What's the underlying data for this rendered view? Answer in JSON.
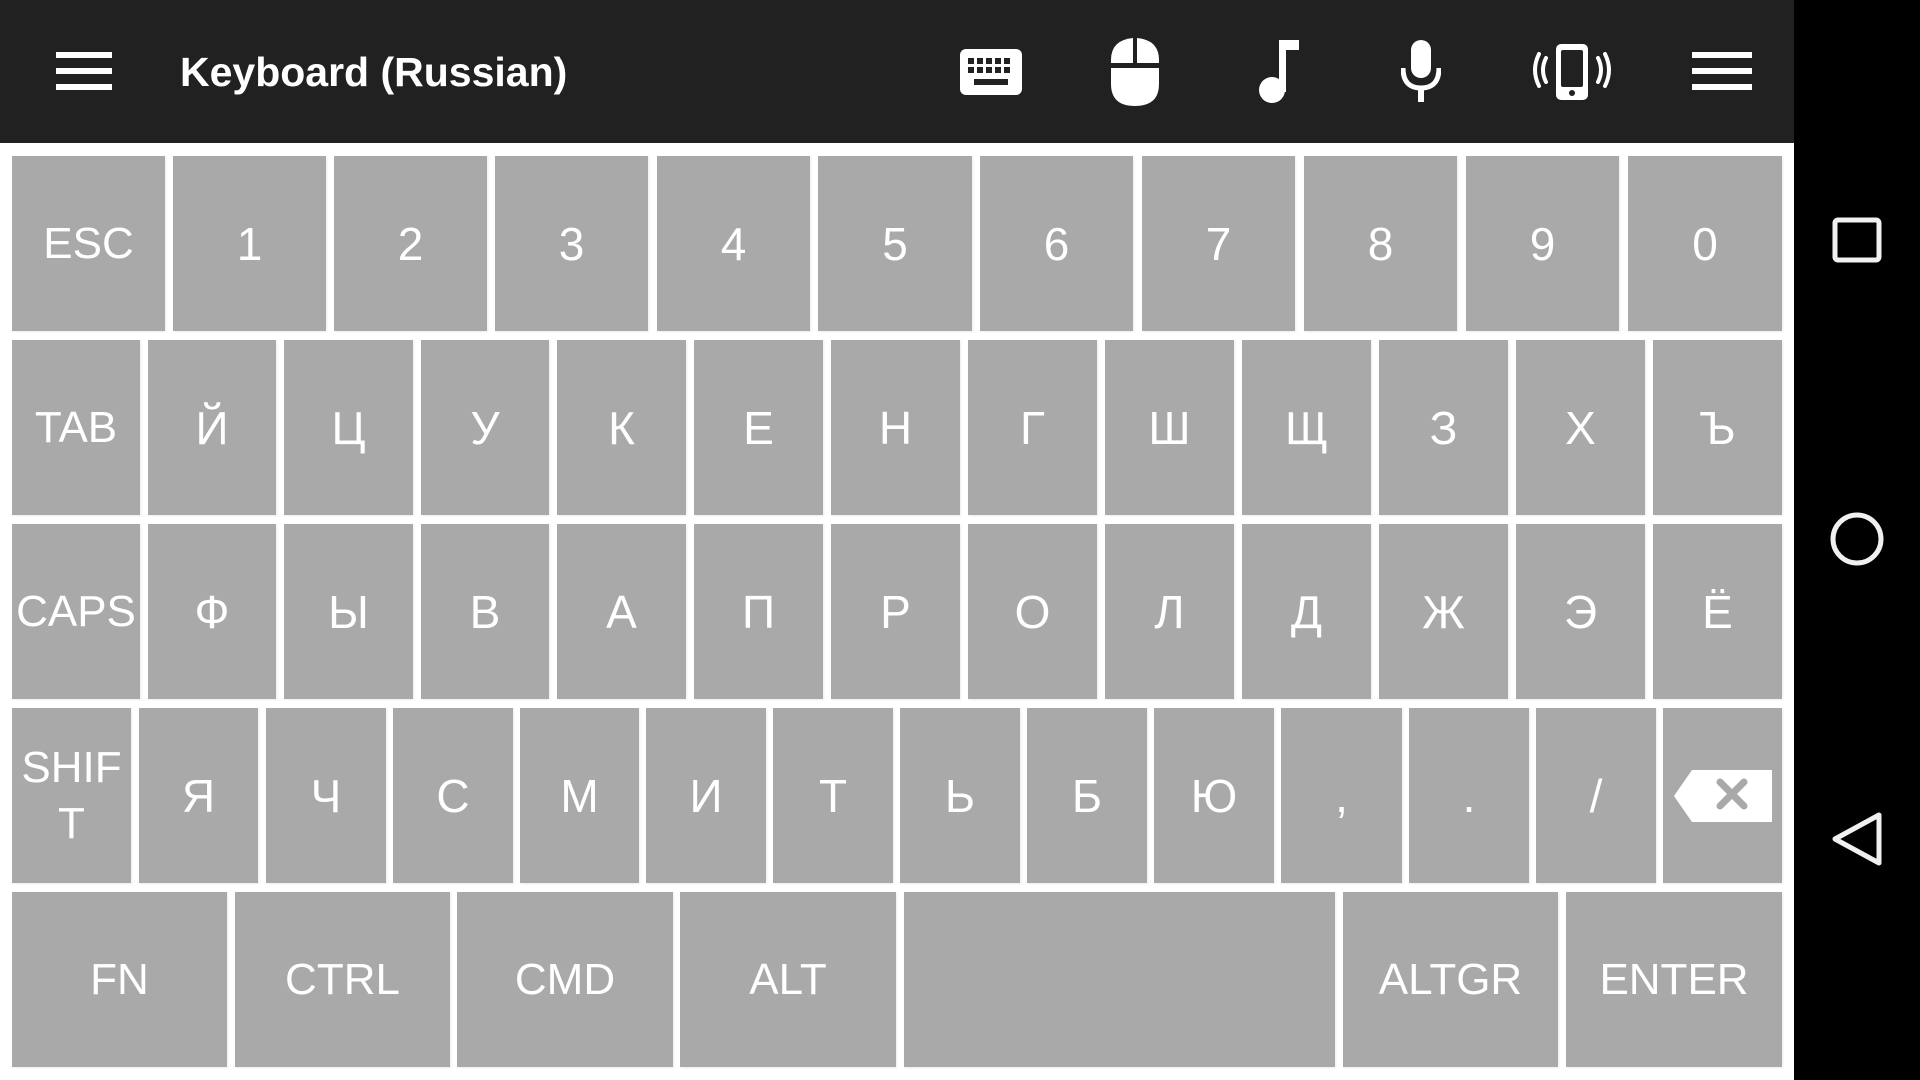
{
  "app": {
    "title": "Keyboard (Russian)"
  },
  "toolbar": {
    "icons": [
      "menu-icon",
      "keyboard-icon",
      "mouse-icon",
      "music-note-icon",
      "microphone-icon",
      "vibrate-phone-icon",
      "menu-icon"
    ]
  },
  "keyboard": {
    "rows": [
      [
        "ESC",
        "1",
        "2",
        "3",
        "4",
        "5",
        "6",
        "7",
        "8",
        "9",
        "0"
      ],
      [
        "TAB",
        "Й",
        "Ц",
        "У",
        "К",
        "Е",
        "Н",
        "Г",
        "Ш",
        "Щ",
        "З",
        "Х",
        "Ъ"
      ],
      [
        "CAPS",
        "Ф",
        "Ы",
        "В",
        "А",
        "П",
        "Р",
        "О",
        "Л",
        "Д",
        "Ж",
        "Э",
        "Ё"
      ],
      [
        "SHIFT",
        "Я",
        "Ч",
        "С",
        "М",
        "И",
        "Т",
        "Ь",
        "Б",
        "Ю",
        ",",
        ".",
        "/",
        ""
      ],
      [
        "FN",
        "CTRL",
        "CMD",
        "ALT",
        "",
        "ALTGR",
        "ENTER"
      ]
    ],
    "backspace_icon": "backspace-icon",
    "key_color": "#a9a9a9",
    "key_text_color": "#ffffff"
  },
  "colors": {
    "topbar": "#212121",
    "background": "#ffffff",
    "navbar": "#000000"
  },
  "navbar": {
    "buttons": [
      "recent-apps-icon",
      "home-icon",
      "back-icon"
    ]
  }
}
